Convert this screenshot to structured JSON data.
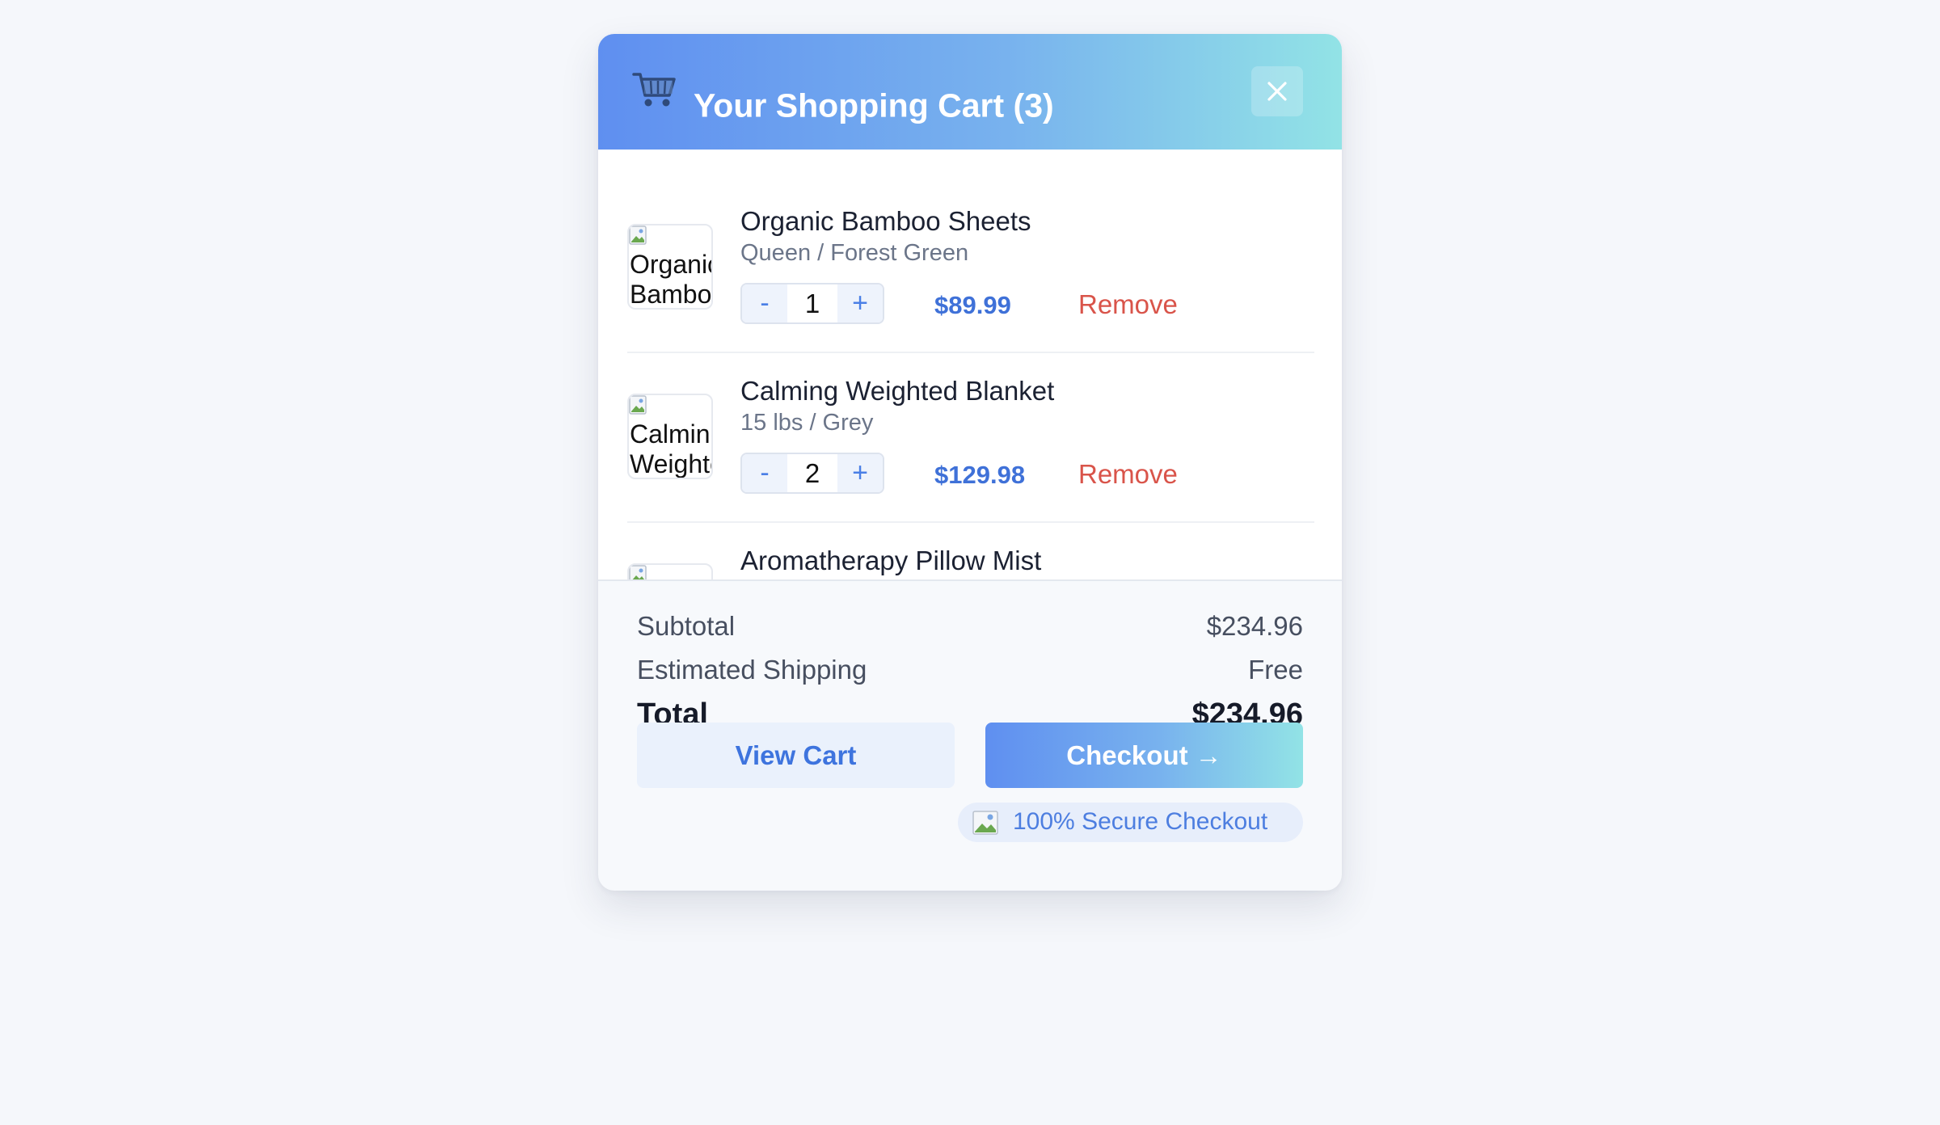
{
  "cart": {
    "title": "Your Shopping Cart (3)",
    "icon": "shopping-cart-icon",
    "close_icon": "close-icon"
  },
  "items": [
    {
      "name": "Organic Bamboo Sheets",
      "image_alt": "Organic Bamboo Sheets",
      "variant": "Queen / Forest Green",
      "qty": "1",
      "price": "$89.99",
      "remove_label": "Remove"
    },
    {
      "name": "Calming Weighted Blanket",
      "image_alt": "Calming Weighted Blanket",
      "variant": "15 lbs / Grey",
      "qty": "2",
      "price": "$129.98",
      "remove_label": "Remove"
    },
    {
      "name": "Aromatherapy Pillow Mist"
    }
  ],
  "stepper": {
    "minus": "-",
    "plus": "+"
  },
  "summary": {
    "subtotal_label": "Subtotal",
    "subtotal_value": "$234.96",
    "shipping_label": "Estimated Shipping",
    "shipping_value": "Free",
    "total_label": "Total",
    "total_value": "$234.96"
  },
  "actions": {
    "view_cart": "View Cart",
    "checkout": "Checkout →"
  },
  "secure": {
    "label": "100% Secure Checkout"
  },
  "colors": {
    "accent": "#3f71d8",
    "gradient_start": "#5f8ff0",
    "gradient_end": "#92e3e6",
    "remove": "#d9544a"
  }
}
